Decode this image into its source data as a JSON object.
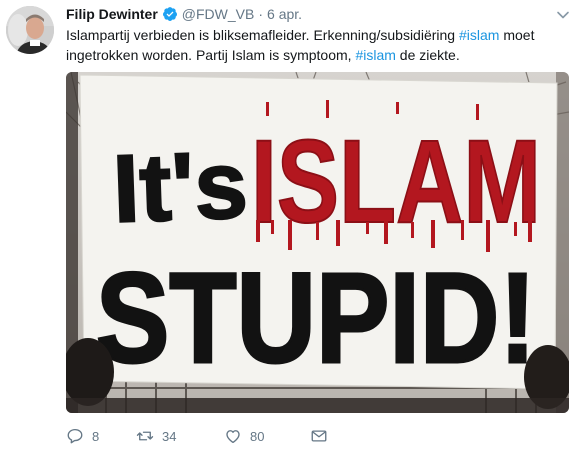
{
  "tweet": {
    "author_name": "Filip Dewinter",
    "handle": "@FDW_VB",
    "separator": "·",
    "timestamp": "6 apr.",
    "text_line1_prefix": "Islampartij verbieden is bliksemafleider. Erkenning/subsidiëring ",
    "hashtag1": "#islam",
    "text_line1_suffix": " moet",
    "text_line2_prefix": "ingetrokken worden. Partij Islam is symptoom, ",
    "hashtag2": "#islam",
    "text_line2_suffix": " de ziekte."
  },
  "sign": {
    "line1_black": "It's",
    "line1_red": "ISLAM",
    "line2": "STUPID!"
  },
  "actions": {
    "reply_count": "8",
    "retweet_count": "34",
    "like_count": "80"
  },
  "icons": {
    "verified": "verified-badge-icon",
    "chevron": "chevron-down-icon",
    "reply": "reply-icon",
    "retweet": "retweet-icon",
    "like": "heart-icon",
    "dm": "envelope-icon"
  },
  "colors": {
    "text": "#14171a",
    "secondary": "#657786",
    "link": "#1b95e0",
    "verified": "#1da1f2",
    "sign_red": "#b3171f"
  }
}
